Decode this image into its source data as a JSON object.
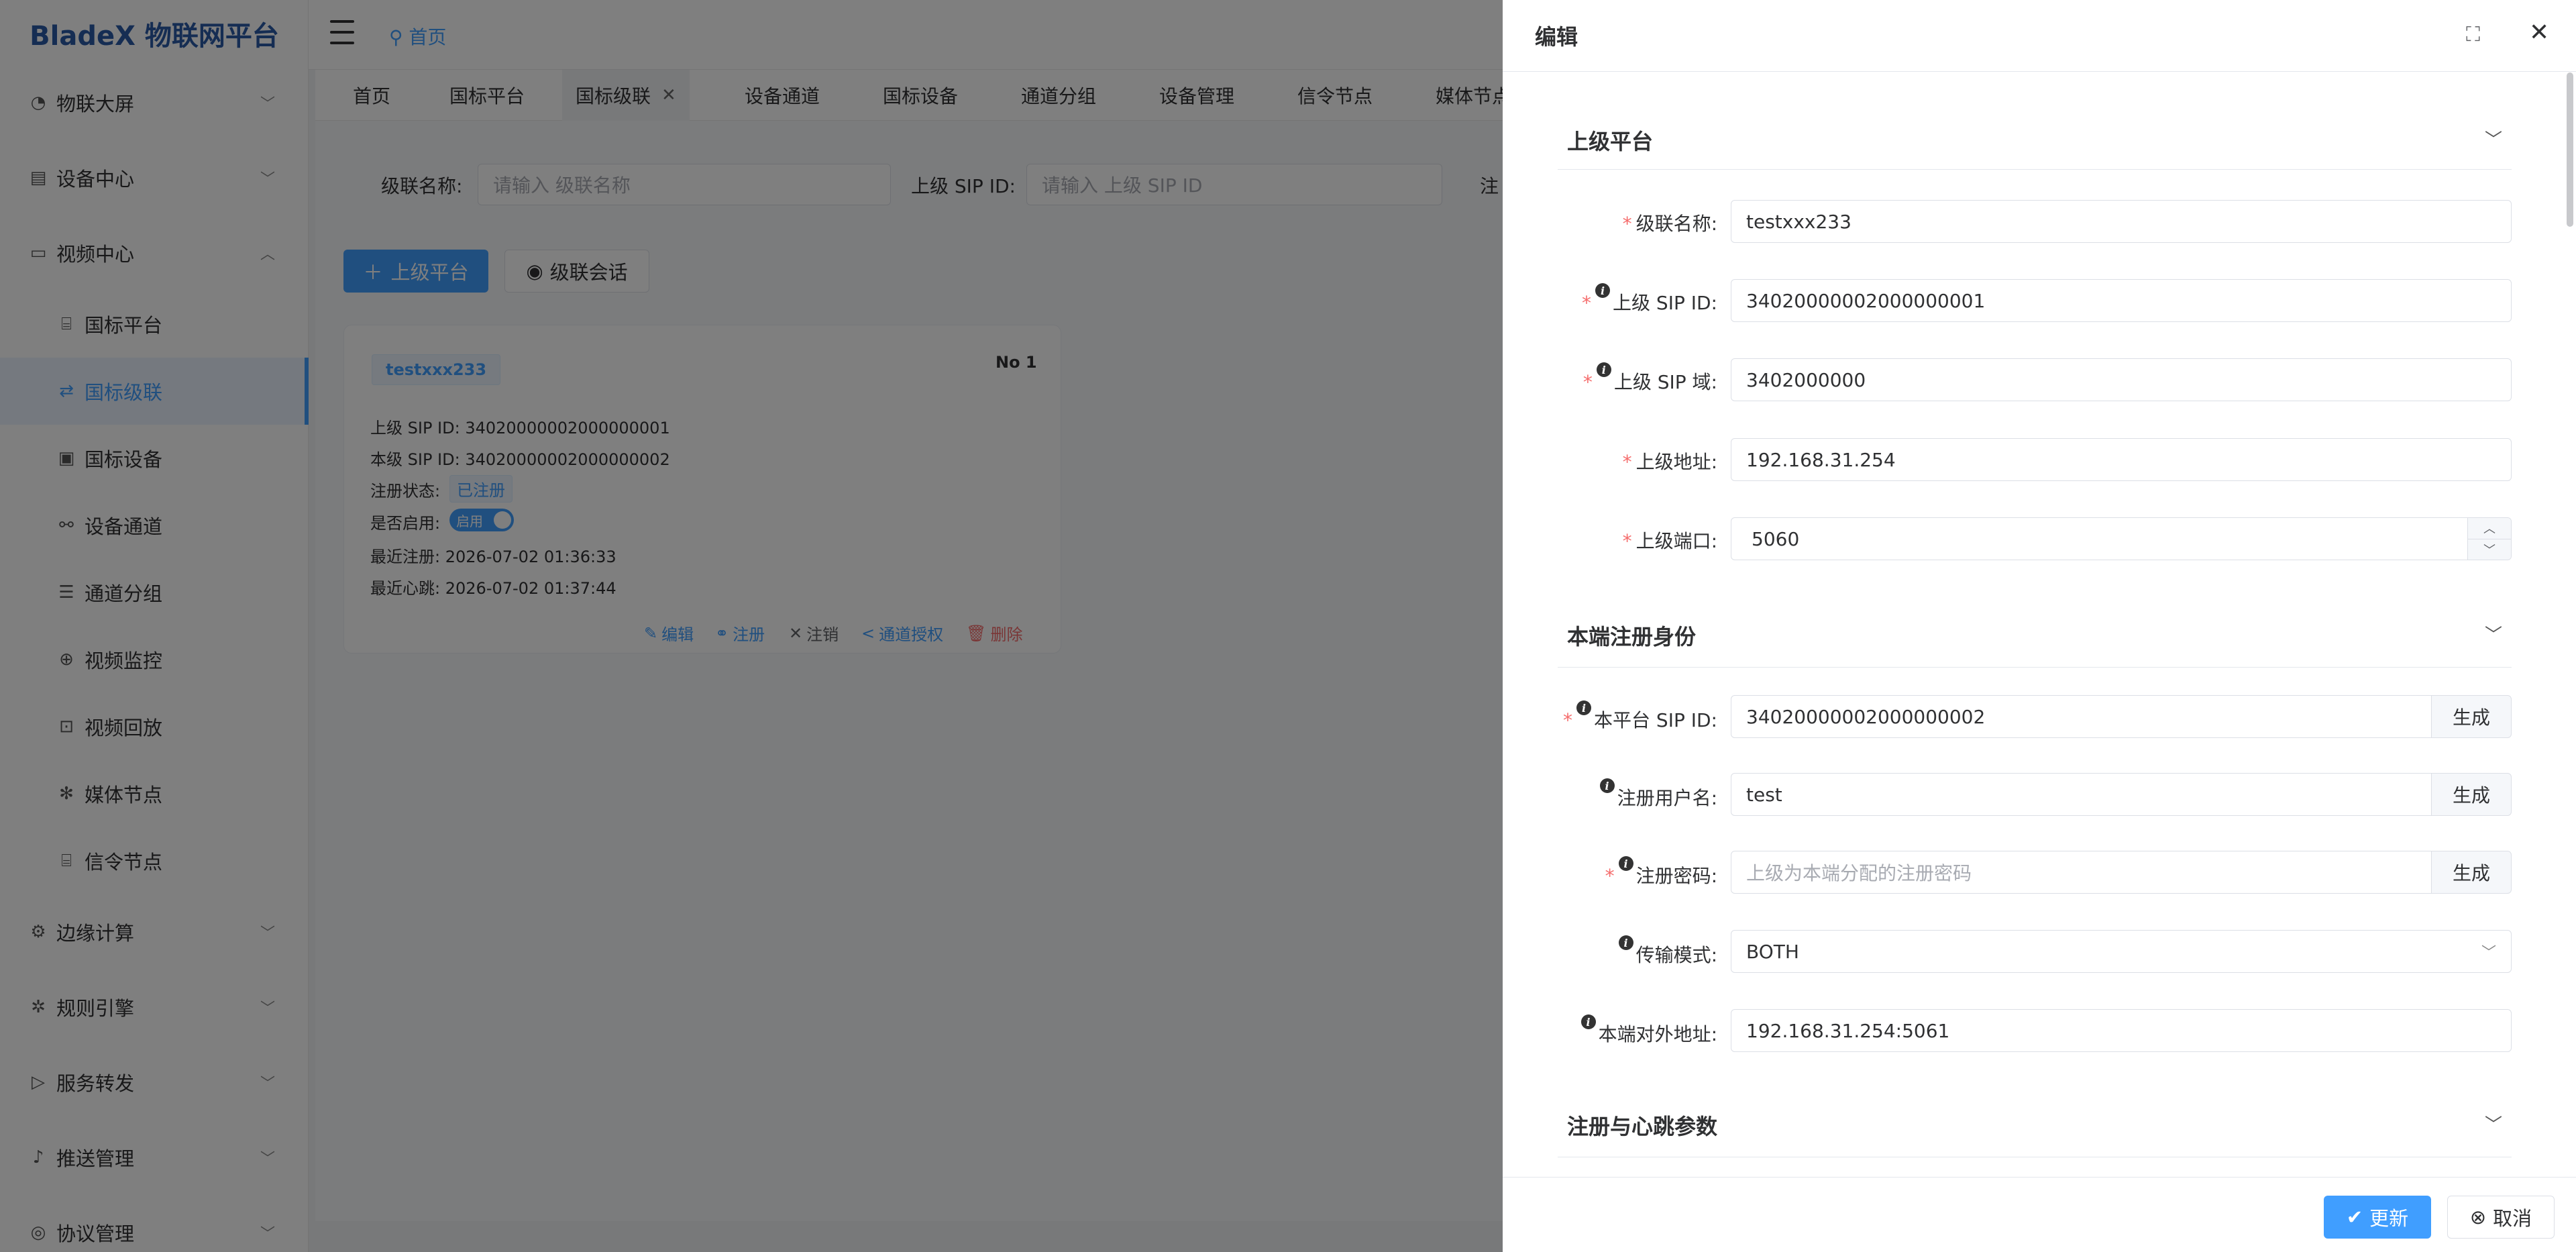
{
  "app": {
    "title": "BladeX 物联网平台"
  },
  "header": {
    "home_label": "首页"
  },
  "sidebar": {
    "items": [
      {
        "label": "物联大屏",
        "icon": "dashboard-icon"
      },
      {
        "label": "设备中心",
        "icon": "device-icon"
      },
      {
        "label": "视频中心",
        "icon": "video-icon"
      },
      {
        "label": "国标平台",
        "icon": "platform-icon"
      },
      {
        "label": "国标级联",
        "icon": "cascade-icon"
      },
      {
        "label": "国标设备",
        "icon": "gb-device-icon"
      },
      {
        "label": "设备通道",
        "icon": "channel-icon"
      },
      {
        "label": "通道分组",
        "icon": "group-icon"
      },
      {
        "label": "视频监控",
        "icon": "camera-icon"
      },
      {
        "label": "视频回放",
        "icon": "playback-icon"
      },
      {
        "label": "媒体节点",
        "icon": "media-node-icon"
      },
      {
        "label": "信令节点",
        "icon": "signal-node-icon"
      },
      {
        "label": "边缘计算",
        "icon": "edge-icon"
      },
      {
        "label": "规则引擎",
        "icon": "rule-icon"
      },
      {
        "label": "服务转发",
        "icon": "forward-icon"
      },
      {
        "label": "推送管理",
        "icon": "bell-icon"
      },
      {
        "label": "协议管理",
        "icon": "protocol-icon"
      }
    ]
  },
  "tabs": [
    "首页",
    "国标平台",
    "国标级联",
    "设备通道",
    "国标设备",
    "通道分组",
    "设备管理",
    "信令节点",
    "媒体节点"
  ],
  "search": {
    "name_label": "级联名称:",
    "name_placeholder": "请输入 级联名称",
    "sip_label": "上级 SIP ID:",
    "sip_placeholder": "请输入 上级 SIP ID",
    "cut_label": "注"
  },
  "toolbar": {
    "add_label": "上级平台",
    "session_label": "级联会话"
  },
  "card": {
    "name": "testxxx233",
    "no": "No 1",
    "upper_sip_key": "上级 SIP ID:",
    "upper_sip_val": "34020000002000000001",
    "local_sip_key": "本级 SIP ID:",
    "local_sip_val": "34020000002000000002",
    "status_key": "注册状态:",
    "status_val": "已注册",
    "enabled_key": "是否启用:",
    "enabled_val": "启用",
    "last_reg_key": "最近注册:",
    "last_reg_val": "2026-07-02 01:36:33",
    "last_hb_key": "最近心跳:",
    "last_hb_val": "2026-07-02 01:37:44",
    "actions": {
      "edit": "编辑",
      "register": "注册",
      "unregister": "注销",
      "auth": "通道授权",
      "delete": "删除"
    }
  },
  "drawer": {
    "title": "编辑",
    "section1": "上级平台",
    "section2": "本端注册身份",
    "section3": "注册与心跳参数",
    "fields": {
      "cascade_name_label": "级联名称:",
      "cascade_name": "testxxx233",
      "upper_sip_id_label": "上级 SIP ID:",
      "upper_sip_id": "34020000002000000001",
      "upper_sip_domain_label": "上级 SIP 域:",
      "upper_sip_domain": "3402000000",
      "upper_addr_label": "上级地址:",
      "upper_addr": "192.168.31.254",
      "upper_port_label": "上级端口:",
      "upper_port": "5060",
      "local_sip_id_label": "本平台 SIP ID:",
      "local_sip_id": "34020000002000000002",
      "reg_user_label": "注册用户名:",
      "reg_user": "test",
      "reg_pwd_label": "注册密码:",
      "reg_pwd_placeholder": "上级为本端分配的注册密码",
      "transport_label": "传输模式:",
      "transport": "BOTH",
      "local_addr_label": "本端对外地址:",
      "local_addr": "192.168.31.254:5061",
      "generate": "生成"
    },
    "update_label": "更新",
    "cancel_label": "取消"
  },
  "colors": {
    "primary": "#409eff",
    "danger": "#f56c6c",
    "brand": "#2b5aa6"
  }
}
